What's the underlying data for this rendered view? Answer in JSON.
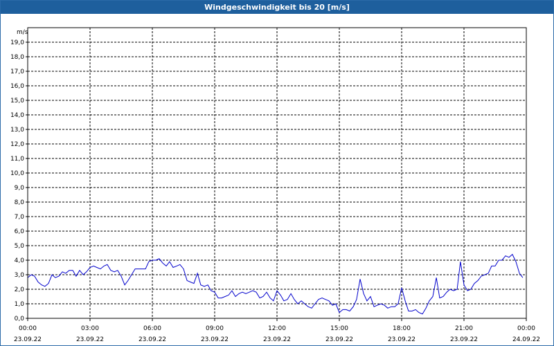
{
  "window": {
    "title": "Windgeschwindigkeit bis 20 [m/s]"
  },
  "chart_data": {
    "type": "line",
    "title": "Windgeschwindigkeit bis 20 [m/s]",
    "ylabel": "m/s",
    "ylim": [
      0,
      20
    ],
    "xlim_hours": [
      0,
      24
    ],
    "grid": true,
    "line_color": "#0000cc",
    "grid_color": "#000000",
    "y_ticks": [
      "0,0",
      "1,0",
      "2,0",
      "3,0",
      "4,0",
      "5,0",
      "6,0",
      "7,0",
      "8,0",
      "9,0",
      "10,0",
      "11,0",
      "12,0",
      "13,0",
      "14,0",
      "15,0",
      "16,0",
      "17,0",
      "18,0",
      "19,0"
    ],
    "x_ticks": [
      {
        "time": "00:00",
        "date": "23.09.22"
      },
      {
        "time": "03:00",
        "date": "23.09.22"
      },
      {
        "time": "06:00",
        "date": "23.09.22"
      },
      {
        "time": "09:00",
        "date": "23.09.22"
      },
      {
        "time": "12:00",
        "date": "23.09.22"
      },
      {
        "time": "15:00",
        "date": "23.09.22"
      },
      {
        "time": "18:00",
        "date": "23.09.22"
      },
      {
        "time": "21:00",
        "date": "23.09.22"
      },
      {
        "time": "00:00",
        "date": "24.09.22"
      }
    ],
    "series": [
      {
        "x": [
          0,
          0.17,
          0.33,
          0.5,
          0.67,
          0.83,
          1,
          1.17,
          1.33,
          1.5,
          1.67,
          1.83,
          2,
          2.17,
          2.33,
          2.5,
          2.67,
          2.83,
          3,
          3.17,
          3.33,
          3.5,
          3.67,
          3.83,
          4,
          4.17,
          4.33,
          4.5,
          4.67,
          4.83,
          5,
          5.17,
          5.33,
          5.5,
          5.67,
          5.83,
          6,
          6.17,
          6.33,
          6.5,
          6.67,
          6.83,
          7,
          7.17,
          7.33,
          7.5,
          7.67,
          7.83,
          8,
          8.17,
          8.33,
          8.5,
          8.67,
          8.83,
          9,
          9.17,
          9.33,
          9.5,
          9.67,
          9.83,
          10,
          10.17,
          10.33,
          10.5,
          10.67,
          10.83,
          11,
          11.17,
          11.33,
          11.5,
          11.67,
          11.83,
          12,
          12.17,
          12.33,
          12.5,
          12.67,
          12.83,
          13,
          13.17,
          13.33,
          13.5,
          13.67,
          13.83,
          14,
          14.17,
          14.33,
          14.5,
          14.67,
          14.83,
          15,
          15.17,
          15.33,
          15.5,
          15.67,
          15.83,
          16,
          16.17,
          16.33,
          16.5,
          16.67,
          16.83,
          17,
          17.17,
          17.33,
          17.5,
          17.67,
          17.83,
          18,
          18.17,
          18.33,
          18.5,
          18.67,
          18.83,
          19,
          19.17,
          19.33,
          19.5,
          19.67,
          19.83,
          20,
          20.17,
          20.33,
          20.5,
          20.67,
          20.83,
          21,
          21.17,
          21.33,
          21.5,
          21.67,
          21.83,
          22,
          22.17,
          22.33,
          22.5,
          22.67,
          22.83,
          23,
          23.17,
          23.33,
          23.5,
          23.67,
          23.83
        ],
        "y": [
          2.8,
          3.0,
          2.9,
          2.5,
          2.3,
          2.2,
          2.4,
          3.0,
          2.8,
          2.9,
          3.2,
          3.1,
          3.3,
          3.3,
          2.9,
          3.3,
          3.0,
          3.2,
          3.5,
          3.6,
          3.5,
          3.4,
          3.6,
          3.7,
          3.3,
          3.2,
          3.3,
          2.9,
          2.3,
          2.6,
          3.0,
          3.4,
          3.4,
          3.4,
          3.4,
          3.9,
          4.0,
          4.0,
          4.1,
          3.8,
          3.6,
          3.9,
          3.5,
          3.6,
          3.7,
          3.4,
          2.6,
          2.5,
          2.4,
          3.1,
          2.3,
          2.2,
          2.3,
          1.9,
          1.8,
          1.4,
          1.4,
          1.5,
          1.6,
          1.9,
          1.5,
          1.7,
          1.8,
          1.7,
          1.8,
          1.9,
          1.8,
          1.4,
          1.5,
          1.8,
          1.4,
          1.2,
          1.9,
          1.6,
          1.2,
          1.3,
          1.7,
          1.3,
          1.0,
          1.2,
          1.0,
          0.8,
          0.7,
          1.0,
          1.3,
          1.4,
          1.3,
          1.2,
          0.9,
          1.0,
          0.4,
          0.6,
          0.6,
          0.5,
          0.8,
          1.3,
          2.7,
          1.7,
          1.2,
          1.5,
          0.8,
          0.9,
          1.0,
          0.9,
          0.7,
          0.8,
          0.8,
          1.0,
          2.1,
          1.2,
          0.5,
          0.5,
          0.6,
          0.4,
          0.3,
          0.7,
          1.2,
          1.5,
          2.8,
          1.4,
          1.5,
          1.8,
          2.0,
          1.9,
          2.0,
          3.9,
          2.3,
          1.9,
          2.0,
          2.4,
          2.6,
          2.9,
          3.0,
          3.1,
          3.6,
          3.6,
          4.0,
          4.0,
          4.3,
          4.2,
          4.4,
          3.9,
          3.1,
          2.8
        ]
      }
    ]
  }
}
